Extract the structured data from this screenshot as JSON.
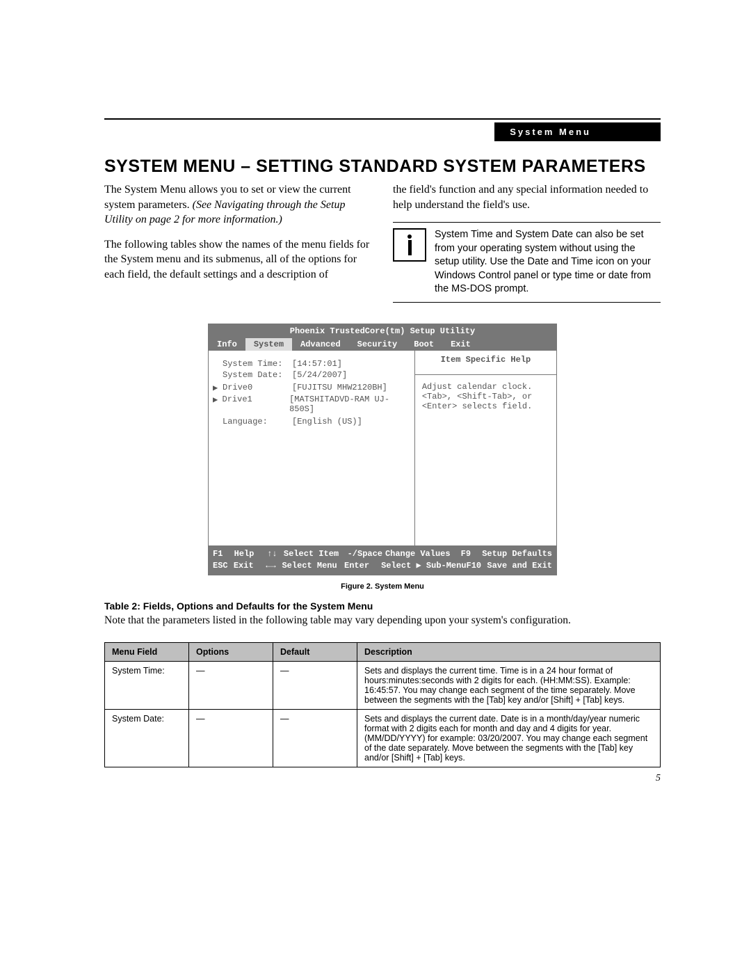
{
  "header": {
    "tab_label": "System Menu"
  },
  "title": "SYSTEM MENU – SETTING STANDARD SYSTEM PARAMETERS",
  "left_col": {
    "p1a": "The System Menu allows you to set or view the current system parameters. ",
    "p1b": "(See Navigating through the Setup Utility on page 2 for more information.)",
    "p2": "The following tables show the names of the menu fields for the System menu and its submenus, all of the options for each field, the default settings and a description of"
  },
  "right_col": {
    "p1": "the field's function and any special information needed to help understand the field's use.",
    "info_text": "System Time and System Date can also be set from your operating system without using the setup utility. Use the Date and Time icon on your Windows Control panel or type time or date from the MS-DOS prompt."
  },
  "bios": {
    "title": "Phoenix TrustedCore(tm) Setup Utility",
    "menu": [
      "Info",
      "System",
      "Advanced",
      "Security",
      "Boot",
      "Exit"
    ],
    "active_menu_index": 1,
    "rows": [
      {
        "tri": " ",
        "label": "System Time:",
        "value": "[14:57:01]"
      },
      {
        "tri": " ",
        "label": "System Date:",
        "value": "[5/24/2007]"
      },
      {
        "tri": " ",
        "label": "",
        "value": ""
      },
      {
        "tri": "▶",
        "label": "Drive0",
        "value": "[FUJITSU MHW2120BH]"
      },
      {
        "tri": "▶",
        "label": "Drive1",
        "value": "[MATSHITADVD-RAM UJ-850S]"
      },
      {
        "tri": " ",
        "label": "",
        "value": ""
      },
      {
        "tri": " ",
        "label": "Language:",
        "value": "[English (US)]"
      }
    ],
    "help_title": "Item Specific Help",
    "help_lines": [
      "Adjust calendar clock.",
      "",
      "<Tab>, <Shift-Tab>, or",
      "<Enter> selects field."
    ],
    "footer": {
      "row1": {
        "k1": "F1",
        "l1": "Help",
        "arr": "↑↓",
        "a1": "Select Item",
        "k2": "-/Space",
        "a2": "Change Values",
        "k3": "F9",
        "a3": "Setup Defaults"
      },
      "row2": {
        "k1": "ESC",
        "l1": "Exit",
        "arr": "←→",
        "a1": "Select Menu",
        "k2": "Enter",
        "a2": "Select ▶ Sub-Menu",
        "k3": "F10",
        "a3": "Save and Exit"
      }
    }
  },
  "figure_caption": "Figure 2.  System Menu",
  "table_title": "Table 2: Fields, Options and Defaults for the System Menu",
  "table_note": "Note that the parameters listed in the following table may vary depending upon your system's configuration.",
  "table": {
    "headers": [
      "Menu Field",
      "Options",
      "Default",
      "Description"
    ],
    "rows": [
      {
        "menu": "System Time:",
        "options": "—",
        "default": "—",
        "desc": "Sets and displays the current time. Time is in a 24 hour format of hours:minutes:seconds with 2 digits for each. (HH:MM:SS). Example: 16:45:57. You may change each segment of the time separately. Move between the segments with the [Tab] key and/or [Shift] + [Tab] keys."
      },
      {
        "menu": "System Date:",
        "options": "—",
        "default": "—",
        "desc": "Sets and displays the current date. Date is in a month/day/year numeric format with 2 digits each for month and day and 4 digits for year. (MM/DD/YYYY) for example: 03/20/2007. You may change each segment of the date separately. Move between the segments with the [Tab] key and/or [Shift] + [Tab] keys."
      }
    ]
  },
  "page_number": "5"
}
